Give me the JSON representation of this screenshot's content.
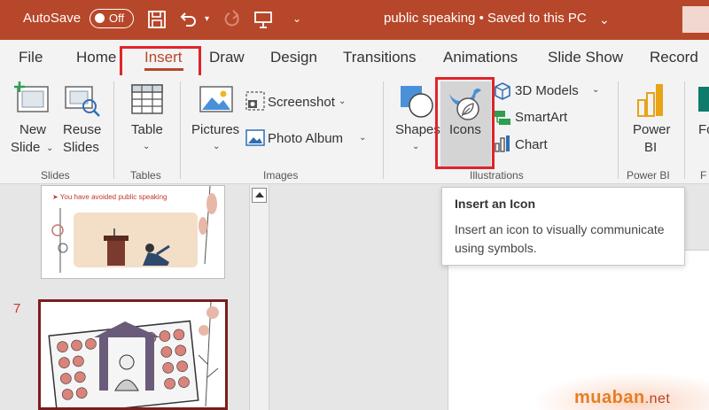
{
  "titlebar": {
    "autosave_label": "AutoSave",
    "autosave_state": "Off",
    "doc_title": "public speaking • Saved to this PC",
    "icons": [
      "save-icon",
      "undo-icon",
      "redo-icon",
      "present-icon",
      "customize-qat-icon"
    ]
  },
  "tabs": [
    "File",
    "Home",
    "Insert",
    "Draw",
    "Design",
    "Transitions",
    "Animations",
    "Slide Show",
    "Record"
  ],
  "active_tab": "Insert",
  "ribbon": {
    "slides": {
      "new_slide_1": "New",
      "new_slide_2": "Slide",
      "reuse_1": "Reuse",
      "reuse_2": "Slides",
      "group": "Slides"
    },
    "tables": {
      "table": "Table",
      "group": "Tables"
    },
    "images": {
      "pictures": "Pictures",
      "screenshot": "Screenshot",
      "photo_album": "Photo Album",
      "group": "Images"
    },
    "illustrations": {
      "shapes": "Shapes",
      "icons": "Icons",
      "models_3d": "3D Models",
      "smartart": "SmartArt",
      "chart": "Chart",
      "group": "Illustrations"
    },
    "powerbi": {
      "label_1": "Power",
      "label_2": "BI",
      "group": "Power BI"
    },
    "forms": {
      "label_1": "Fo",
      "group": "F"
    }
  },
  "tooltip": {
    "title": "Insert an Icon",
    "body": "Insert an icon to visually communicate using symbols."
  },
  "slides_panel": {
    "slide6_text": "You have avoided public speaking",
    "slide7_number": "7"
  },
  "watermark": {
    "brand": "muaban",
    "tld": ".net"
  },
  "colors": {
    "accent": "#b7472a",
    "highlight": "#e0242a",
    "ribbon_bg": "#f3f3f3"
  }
}
